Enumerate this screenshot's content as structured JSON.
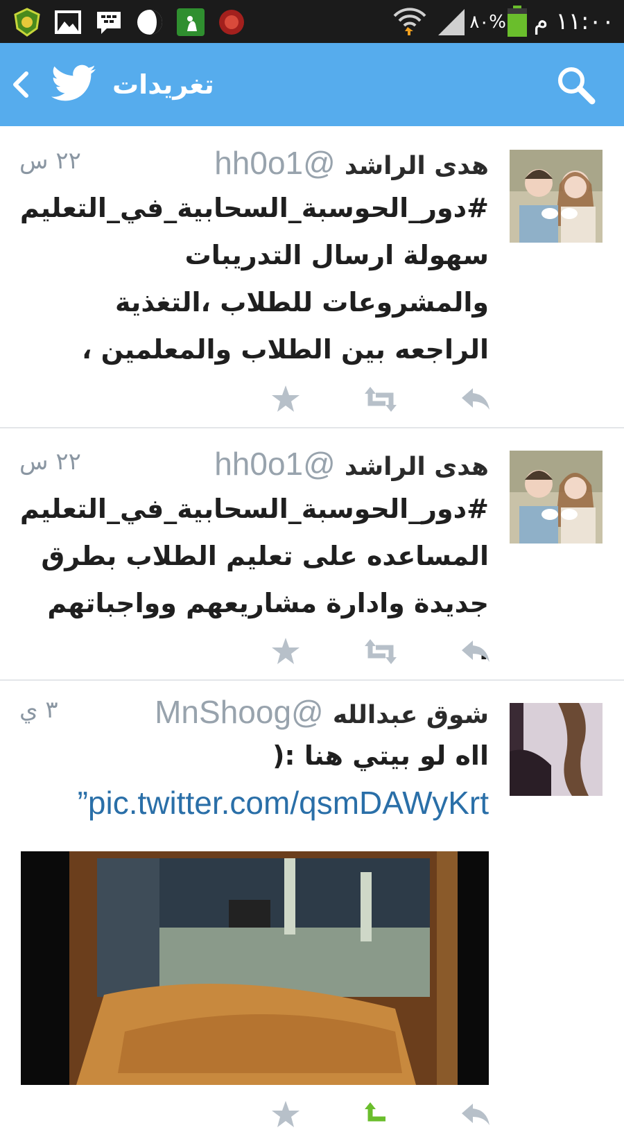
{
  "status_bar": {
    "time": "١١:٠٠ م",
    "battery_percent": "٨٠%",
    "icons": [
      "app-shield-icon",
      "gallery-icon",
      "bbm-icon",
      "moon-icon",
      "prayer-app-icon",
      "islamic-app-icon",
      "wifi-icon",
      "signal-icon",
      "battery-icon"
    ]
  },
  "header": {
    "title": "تغريدات",
    "icons": [
      "back-chevron-icon",
      "twitter-bird-icon",
      "search-icon"
    ],
    "color": "#56aced"
  },
  "tweets": [
    {
      "name": "هدى الراشد",
      "handle": "@hh0o1",
      "time": "٢٢ س",
      "text": "#دور_الحوسبة_السحابية_في_التعليم سهولة ارسال التدريبات والمشروعات للطلاب ،التغذية الراجعه بين الطلاب والمعلمين ،"
    },
    {
      "name": "هدى الراشد",
      "handle": "@hh0o1",
      "time": "٢٢ س",
      "text": "#دور_الحوسبة_السحابية_في_التعليم المساعده على تعليم الطلاب بطرق جديدة وادارة مشاريعهم وواجباتهم ."
    },
    {
      "name": "شوق عبدالله",
      "handle": "@MnShoog",
      "time": "٣ ي",
      "text": "ااه لو بيتي هنا :(",
      "link": "pic.twitter.com/qsmDAWyKrt”"
    }
  ],
  "actions": [
    "reply-icon",
    "retweet-icon",
    "favorite-icon"
  ]
}
